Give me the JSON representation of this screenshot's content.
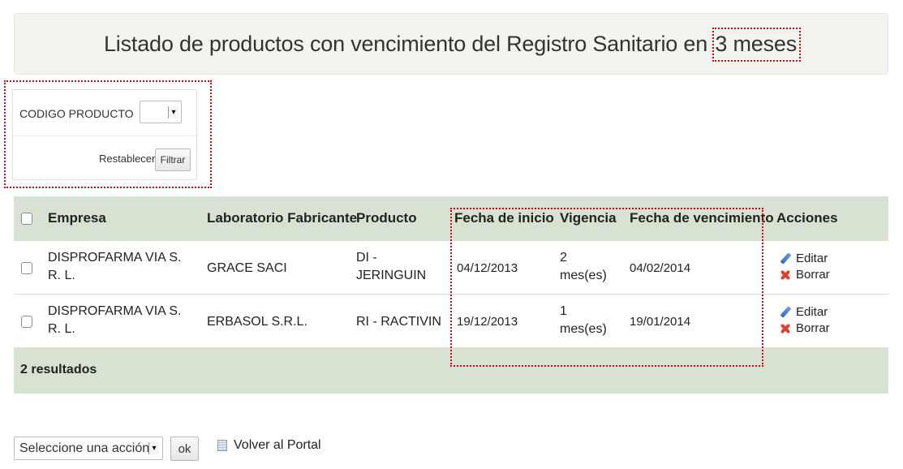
{
  "page": {
    "title_prefix": "Listado de productos con vencimiento del Registro Sanitario en",
    "title_highlight": "3 meses"
  },
  "filter": {
    "label": "CODIGO PRODUCTO",
    "select_value": "",
    "reset_label": "Restablecer",
    "filter_button": "Filtrar"
  },
  "table": {
    "headers": {
      "empresa": "Empresa",
      "laboratorio": "Laboratorio Fabricante",
      "producto": "Producto",
      "fecha_inicio": "Fecha de inicio",
      "vigencia": "Vigencia",
      "fecha_vencimiento": "Fecha de vencimiento",
      "acciones": "Acciones"
    },
    "rows": [
      {
        "empresa_l1": "DISPROFARMA VIA S.",
        "empresa_l2": "R. L.",
        "laboratorio": "GRACE SACI",
        "producto_l1": "DI -",
        "producto_l2": "JERINGUIN",
        "fecha_inicio": "04/12/2013",
        "vigencia_l1": "2",
        "vigencia_l2": "mes(es)",
        "fecha_vencimiento": "04/02/2014"
      },
      {
        "empresa_l1": "DISPROFARMA VIA S.",
        "empresa_l2": "R. L.",
        "laboratorio": "ERBASOL S.R.L.",
        "producto": "RI - RACTIVIN",
        "fecha_inicio": "19/12/2013",
        "vigencia_l1": "1",
        "vigencia_l2": "mes(es)",
        "fecha_vencimiento": "19/01/2014"
      }
    ],
    "actions": {
      "edit": "Editar",
      "delete": "Borrar"
    },
    "results": "2 resultados"
  },
  "bottom": {
    "action_select": "Seleccione una acción",
    "ok_button": "ok",
    "portal_link": "Volver al Portal"
  },
  "colors": {
    "header_bg": "#d8e2d3",
    "title_bg": "#f3f3ef",
    "annotation": "#d9000d"
  },
  "icons": [
    "pencil-icon",
    "x-icon",
    "document-icon",
    "dropdown-arrow-icon"
  ]
}
